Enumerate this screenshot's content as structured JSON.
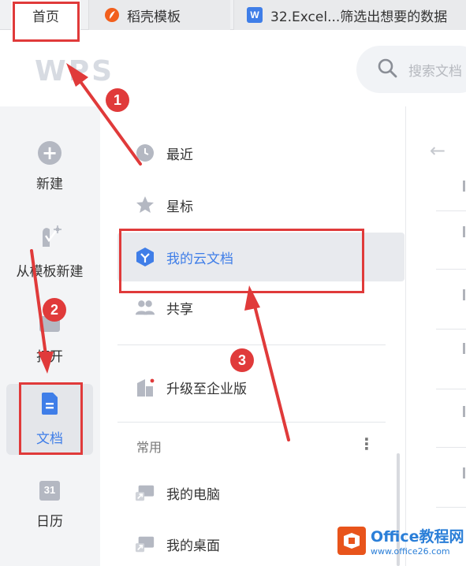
{
  "tabs": [
    {
      "label": "首页"
    },
    {
      "label": "稻壳模板"
    },
    {
      "label": "32.Excel...筛选出想要的数据",
      "icon_letter": "W"
    }
  ],
  "header": {
    "logo": "WPS",
    "search_placeholder": "搜索文档"
  },
  "rail": {
    "items": [
      {
        "label": "新建",
        "icon": "plus-circle-icon"
      },
      {
        "label": "从模板新建",
        "icon": "template-icon"
      },
      {
        "label": "打开",
        "icon": "folder-icon"
      },
      {
        "label": "文档",
        "icon": "document-icon",
        "active": true
      },
      {
        "label": "日历",
        "icon": "calendar-icon",
        "day": "31"
      }
    ]
  },
  "nav": {
    "items": [
      {
        "label": "最近",
        "icon": "clock-icon"
      },
      {
        "label": "星标",
        "icon": "star-icon"
      },
      {
        "label": "我的云文档",
        "icon": "cloud-doc-icon",
        "active": true
      },
      {
        "label": "共享",
        "icon": "people-icon"
      },
      {
        "label": "升级至企业版",
        "icon": "building-icon"
      }
    ],
    "section": {
      "label": "常用",
      "more": "⋮"
    },
    "common": [
      {
        "label": "我的电脑",
        "icon": "computer-shortcut-icon"
      },
      {
        "label": "我的桌面",
        "icon": "desktop-shortcut-icon"
      }
    ]
  },
  "annotations": {
    "badges": [
      "1",
      "2",
      "3"
    ],
    "color": "#e03a3a"
  },
  "watermark": {
    "title": "Office教程网",
    "url": "www.office26.com"
  },
  "colors": {
    "accent": "#3f7ee8",
    "annotation": "#e03a3a",
    "watermark": "#2b7fd8"
  }
}
